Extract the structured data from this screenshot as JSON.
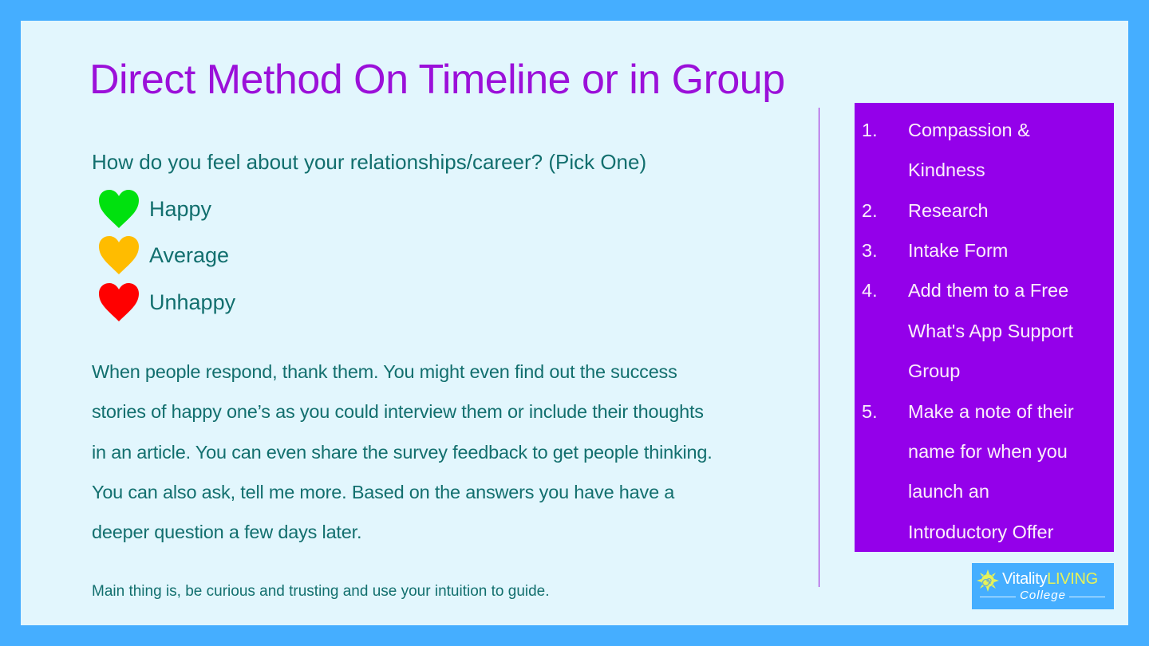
{
  "slide": {
    "title": "Direct Method On Timeline or in Group",
    "question": "How do you feel about your relationships/career? (Pick One)",
    "options": [
      {
        "label": "Happy",
        "icon": "heart-icon",
        "color": "#00E10E"
      },
      {
        "label": "Average",
        "icon": "heart-icon",
        "color": "#FFBC00"
      },
      {
        "label": "Unhappy",
        "icon": "heart-icon",
        "color": "#FF0000"
      }
    ],
    "paragraph_lines": [
      "When people respond, thank them.  You might even find out the success",
      "stories of happy one’s as you could interview them or include their thoughts",
      "in an article. You can even share the survey feedback to get people thinking.",
      "You can also ask, tell me more. Based on the answers you have have a",
      "deeper question a few days later."
    ],
    "footer_note": "Main thing is, be curious and trusting and use your intuition to guide."
  },
  "steps": {
    "items": [
      {
        "number": "1.",
        "lines": [
          "Compassion &",
          "Kindness"
        ]
      },
      {
        "number": "2.",
        "lines": [
          "Research"
        ]
      },
      {
        "number": "3.",
        "lines": [
          "Intake Form"
        ]
      },
      {
        "number": "4.",
        "lines": [
          "Add them to a  Free",
          "What's App Support",
          "Group"
        ]
      },
      {
        "number": "5.",
        "lines": [
          "Make a note of their",
          "name for when you",
          "launch an",
          "Introductory Offer"
        ]
      }
    ]
  },
  "logo": {
    "icon": "sun-spiral-icon",
    "brand_white": "Vitality",
    "brand_yellow": "LIVING",
    "subtitle": "College"
  },
  "colors": {
    "frame": "#45AEFF",
    "background": "#E2F6FD",
    "title": "#9B10D9",
    "body_text": "#126F6E",
    "steps_panel": "#9400EA",
    "steps_text": "#FCEFFB"
  }
}
